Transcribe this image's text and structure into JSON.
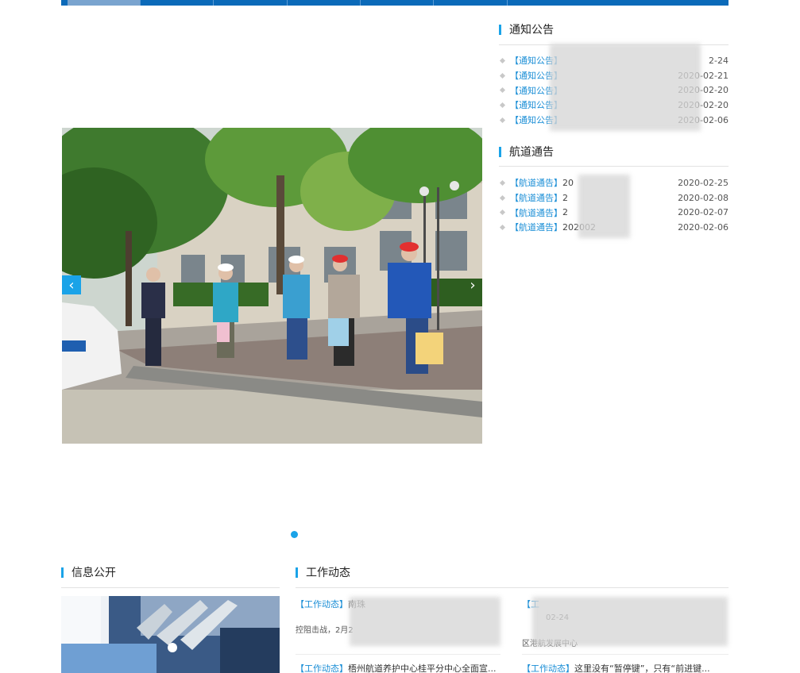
{
  "nav_segments": [
    "",
    "",
    "",
    "",
    "",
    "",
    ""
  ],
  "carousel": {
    "prev_label": "‹",
    "next_label": "›"
  },
  "notice": {
    "title": "通知公告",
    "items": [
      {
        "tag": "【通知公告】",
        "text": "",
        "date": "2-24"
      },
      {
        "tag": "【通知公告】",
        "text": "",
        "date": "2020-02-21"
      },
      {
        "tag": "【通知公告】",
        "text": "",
        "date": "2020-02-20"
      },
      {
        "tag": "【通知公告】",
        "text": "",
        "date": "2020-02-20"
      },
      {
        "tag": "【通知公告】",
        "text": "",
        "date": "2020-02-06"
      }
    ]
  },
  "channel": {
    "title": "航道通告",
    "items": [
      {
        "tag": "【航道通告】",
        "text": "20",
        "date": "2020-02-25"
      },
      {
        "tag": "【航道通告】",
        "text": "2",
        "date": "2020-02-08"
      },
      {
        "tag": "【航道通告】",
        "text": "2",
        "date": "2020-02-07"
      },
      {
        "tag": "【航道通告】",
        "text": "202002",
        "date": "2020-02-06"
      }
    ]
  },
  "info": {
    "title": "信息公开"
  },
  "work": {
    "title": "工作动态",
    "items": [
      {
        "tag": "【工作动态】",
        "headline": "南珠",
        "summary": "",
        "summary2": "控阻击战，2月2"
      },
      {
        "tag": "【工",
        "headline": "",
        "summary": "02-24",
        "summary2": "区港航发展中心"
      },
      {
        "tag": "【工作动态】",
        "headline": "梧州航道养护中心桂平分中心全面宣...",
        "summary": "",
        "summary2": ""
      },
      {
        "tag": "【工作动态】",
        "headline": "这里没有“暂停键”，只有“前进键...",
        "summary": "",
        "summary2": ""
      }
    ]
  },
  "colors": {
    "accent": "#1aa3e8",
    "nav": "#0b6ab9",
    "tag": "#1a8ed6"
  }
}
